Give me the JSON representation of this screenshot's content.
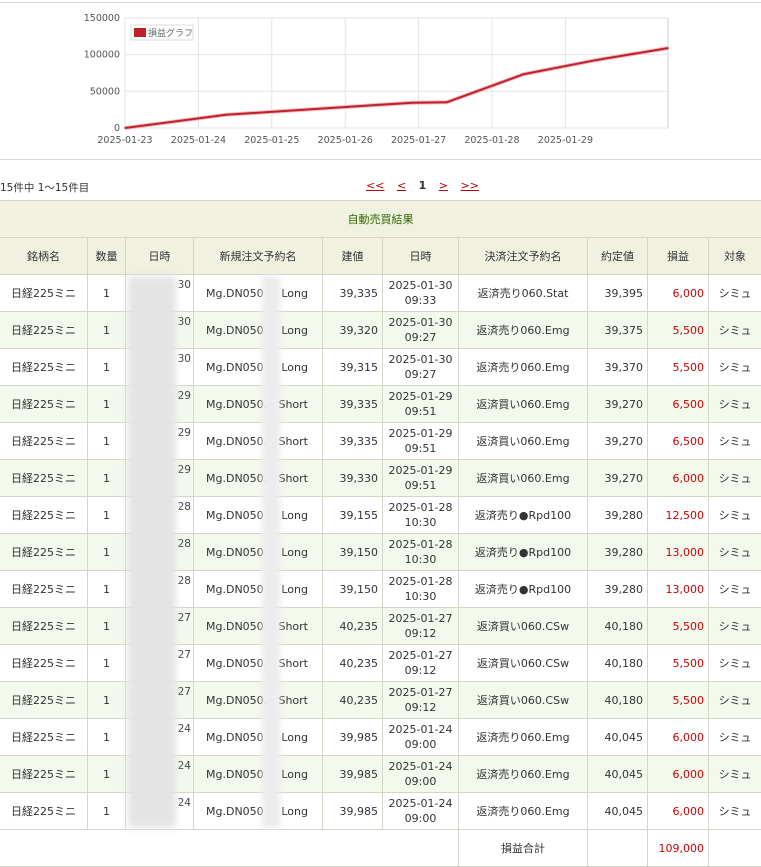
{
  "chart_data": {
    "type": "line",
    "title": "",
    "legend": [
      "損益グラフ"
    ],
    "legend_position": "top-left",
    "xlabel": "",
    "ylabel": "",
    "grid": true,
    "x_ticks": [
      "2025-01-23",
      "2025-01-24",
      "2025-01-25",
      "2025-01-26",
      "2025-01-27",
      "2025-01-28",
      "2025-01-29"
    ],
    "y_ticks": [
      0,
      50000,
      100000,
      150000
    ],
    "ylim": [
      0,
      150000
    ],
    "series": [
      {
        "name": "損益グラフ",
        "color": "#c0202a",
        "x": [
          "2025-01-23 00:00",
          "2025-01-24 09:00",
          "2025-01-26 22:00",
          "2025-01-27 09:12",
          "2025-01-28 10:30",
          "2025-01-29 09:51",
          "2025-01-30 09:33"
        ],
        "y": [
          0,
          18000,
          34500,
          35000,
          73500,
          92500,
          109000
        ]
      }
    ]
  },
  "pager": {
    "count_text": "15件中 1〜15件目",
    "first": "<<",
    "prev": "<",
    "current": "1",
    "next": ">",
    "last": ">>"
  },
  "table": {
    "caption": "自動売買結果",
    "headers": [
      "銘柄名",
      "数量",
      "日時",
      "新規注文予約名",
      "建値",
      "日時",
      "決済注文予約名",
      "約定値",
      "損益",
      "対象"
    ],
    "rows": [
      {
        "name": "日経225ミニ",
        "qty": "1",
        "dt_tail": "30",
        "open_name_prefix": "Mg.DN050",
        "side": "Long",
        "open_price": "39,335",
        "close_date": "2025-01-30",
        "close_time": "09:33",
        "close_name": "返済売り060.Stat",
        "close_price": "39,395",
        "pnl": "6,000",
        "target": "シミュ"
      },
      {
        "name": "日経225ミニ",
        "qty": "1",
        "dt_tail": "30",
        "open_name_prefix": "Mg.DN050",
        "side": "Long",
        "open_price": "39,320",
        "close_date": "2025-01-30",
        "close_time": "09:27",
        "close_name": "返済売り060.Emg",
        "close_price": "39,375",
        "pnl": "5,500",
        "target": "シミュ"
      },
      {
        "name": "日経225ミニ",
        "qty": "1",
        "dt_tail": "30",
        "open_name_prefix": "Mg.DN050",
        "side": "Long",
        "open_price": "39,315",
        "close_date": "2025-01-30",
        "close_time": "09:27",
        "close_name": "返済売り060.Emg",
        "close_price": "39,370",
        "pnl": "5,500",
        "target": "シミュ"
      },
      {
        "name": "日経225ミニ",
        "qty": "1",
        "dt_tail": "29",
        "open_name_prefix": "Mg.DN050.",
        "side": "Short",
        "open_price": "39,335",
        "close_date": "2025-01-29",
        "close_time": "09:51",
        "close_name": "返済買い060.Emg",
        "close_price": "39,270",
        "pnl": "6,500",
        "target": "シミュ"
      },
      {
        "name": "日経225ミニ",
        "qty": "1",
        "dt_tail": "29",
        "open_name_prefix": "Mg.DN050.",
        "side": "Short",
        "open_price": "39,335",
        "close_date": "2025-01-29",
        "close_time": "09:51",
        "close_name": "返済買い060.Emg",
        "close_price": "39,270",
        "pnl": "6,500",
        "target": "シミュ"
      },
      {
        "name": "日経225ミニ",
        "qty": "1",
        "dt_tail": "29",
        "open_name_prefix": "Mg.DN050.",
        "side": "Short",
        "open_price": "39,330",
        "close_date": "2025-01-29",
        "close_time": "09:51",
        "close_name": "返済買い060.Emg",
        "close_price": "39,270",
        "pnl": "6,000",
        "target": "シミュ"
      },
      {
        "name": "日経225ミニ",
        "qty": "1",
        "dt_tail": "28",
        "open_name_prefix": "Mg.DN050",
        "side": "Long",
        "open_price": "39,155",
        "close_date": "2025-01-28",
        "close_time": "10:30",
        "close_name": "返済売り●Rpd100",
        "close_price": "39,280",
        "pnl": "12,500",
        "target": "シミュ"
      },
      {
        "name": "日経225ミニ",
        "qty": "1",
        "dt_tail": "28",
        "open_name_prefix": "Mg.DN050",
        "side": "Long",
        "open_price": "39,150",
        "close_date": "2025-01-28",
        "close_time": "10:30",
        "close_name": "返済売り●Rpd100",
        "close_price": "39,280",
        "pnl": "13,000",
        "target": "シミュ"
      },
      {
        "name": "日経225ミニ",
        "qty": "1",
        "dt_tail": "28",
        "open_name_prefix": "Mg.DN050",
        "side": "Long",
        "open_price": "39,150",
        "close_date": "2025-01-28",
        "close_time": "10:30",
        "close_name": "返済売り●Rpd100",
        "close_price": "39,280",
        "pnl": "13,000",
        "target": "シミュ"
      },
      {
        "name": "日経225ミニ",
        "qty": "1",
        "dt_tail": "27",
        "open_name_prefix": "Mg.DN050.",
        "side": "Short",
        "open_price": "40,235",
        "close_date": "2025-01-27",
        "close_time": "09:12",
        "close_name": "返済買い060.CSw",
        "close_price": "40,180",
        "pnl": "5,500",
        "target": "シミュ"
      },
      {
        "name": "日経225ミニ",
        "qty": "1",
        "dt_tail": "27",
        "open_name_prefix": "Mg.DN050.",
        "side": "Short",
        "open_price": "40,235",
        "close_date": "2025-01-27",
        "close_time": "09:12",
        "close_name": "返済買い060.CSw",
        "close_price": "40,180",
        "pnl": "5,500",
        "target": "シミュ"
      },
      {
        "name": "日経225ミニ",
        "qty": "1",
        "dt_tail": "27",
        "open_name_prefix": "Mg.DN050.",
        "side": "Short",
        "open_price": "40,235",
        "close_date": "2025-01-27",
        "close_time": "09:12",
        "close_name": "返済買い060.CSw",
        "close_price": "40,180",
        "pnl": "5,500",
        "target": "シミュ"
      },
      {
        "name": "日経225ミニ",
        "qty": "1",
        "dt_tail": "24",
        "open_name_prefix": "Mg.DN050",
        "side": "Long",
        "open_price": "39,985",
        "close_date": "2025-01-24",
        "close_time": "09:00",
        "close_name": "返済売り060.Emg",
        "close_price": "40,045",
        "pnl": "6,000",
        "target": "シミュ"
      },
      {
        "name": "日経225ミニ",
        "qty": "1",
        "dt_tail": "24",
        "open_name_prefix": "Mg.DN050",
        "side": "Long",
        "open_price": "39,985",
        "close_date": "2025-01-24",
        "close_time": "09:00",
        "close_name": "返済売り060.Emg",
        "close_price": "40,045",
        "pnl": "6,000",
        "target": "シミュ"
      },
      {
        "name": "日経225ミニ",
        "qty": "1",
        "dt_tail": "24",
        "open_name_prefix": "Mg.DN050",
        "side": "Long",
        "open_price": "39,985",
        "close_date": "2025-01-24",
        "close_time": "09:00",
        "close_name": "返済売り060.Emg",
        "close_price": "40,045",
        "pnl": "6,000",
        "target": "シミュ"
      }
    ],
    "total_label": "損益合計",
    "total_value": "109,000"
  },
  "colors": {
    "pnl_positive": "#cc0000",
    "header_bg": "#f1f1e0",
    "caption_text": "#2d6a00",
    "alt_row_bg": "#f4f9ee",
    "line": "#c0202a"
  }
}
